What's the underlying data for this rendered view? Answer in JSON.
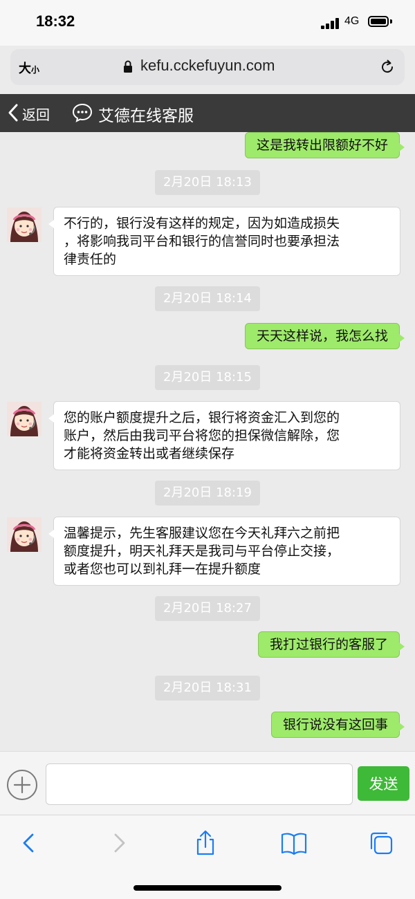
{
  "status": {
    "time": "18:32",
    "network": "4G"
  },
  "browser": {
    "text_size": "大",
    "text_size_small": "小",
    "url": "kefu.cckefuyun.com"
  },
  "nav": {
    "back_label": "返回",
    "title": "艾德在线客服"
  },
  "messages": [
    {
      "type": "out",
      "text": "这是我转出限额好不好"
    },
    {
      "type": "time",
      "text": "2月20日 18:13"
    },
    {
      "type": "in",
      "lines": [
        "不行的，银行没有这样的规定，因为如造成损失",
        "，将影响我司平台和银行的信誉同时也要承担法",
        "律责任的"
      ]
    },
    {
      "type": "time",
      "text": "2月20日 18:14"
    },
    {
      "type": "out",
      "text": "天天这样说，我怎么找"
    },
    {
      "type": "time",
      "text": "2月20日 18:15"
    },
    {
      "type": "in",
      "lines": [
        "您的账户额度提升之后，银行将资金汇入到您的",
        "账户，然后由我司平台将您的担保微信解除，您",
        "才能将资金转出或者继续保存"
      ]
    },
    {
      "type": "time",
      "text": "2月20日 18:19"
    },
    {
      "type": "in",
      "lines": [
        "温馨提示，先生客服建议您在今天礼拜六之前把",
        "额度提升，明天礼拜天是我司与平台停止交接，",
        "或者您也可以到礼拜一在提升额度"
      ]
    },
    {
      "type": "time",
      "text": "2月20日 18:27"
    },
    {
      "type": "out",
      "text": "我打过银行的客服了"
    },
    {
      "type": "time",
      "text": "2月20日 18:31"
    },
    {
      "type": "out",
      "text": "银行说没有这回事"
    }
  ],
  "composer": {
    "input_value": "",
    "send_label": "发送"
  },
  "colors": {
    "outgoing_bubble": "#9eea6a",
    "send_button": "#3fb938",
    "nav_bar": "#3a3a3a",
    "ios_blue": "#1a7cf5"
  },
  "icons": [
    "lock-icon",
    "reload-icon",
    "chevron-left-icon",
    "chat-bubble-icon",
    "agent-avatar",
    "plus-icon",
    "share-icon",
    "bookmarks-icon",
    "tabs-icon"
  ]
}
